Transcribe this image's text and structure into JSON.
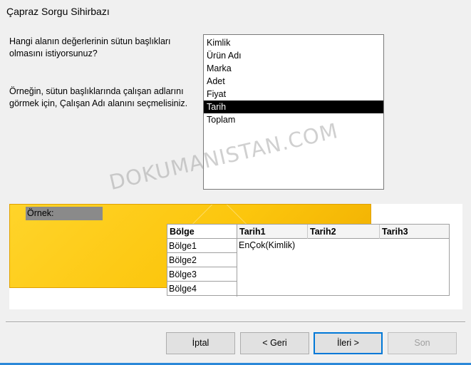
{
  "window": {
    "title": "Çapraz Sorgu Sihirbazı"
  },
  "instructions": {
    "question": "Hangi alanın değerlerinin sütun başlıkları olmasını istiyorsunuz?",
    "hint": "Örneğin, sütun başlıklarında çalışan adlarını görmek için, Çalışan Adı alanını seçmelisiniz."
  },
  "fields_list": {
    "items": [
      "Kimlik",
      "Ürün Adı",
      "Marka",
      "Adet",
      "Fiyat",
      "Tarih",
      "Toplam"
    ],
    "selected_index": 5
  },
  "watermark": "DOKUMANISTAN.COM",
  "sample": {
    "label": "Örnek:",
    "row_header_title": "Bölge",
    "row_values": [
      "Bölge1",
      "Bölge2",
      "Bölge3",
      "Bölge4"
    ],
    "column_headers": [
      "Tarih1",
      "Tarih2",
      "Tarih3"
    ],
    "value_cell": "EnÇok(Kimlik)"
  },
  "buttons": {
    "cancel": "İptal",
    "back": "< Geri",
    "next": "İleri >",
    "finish": "Son"
  },
  "colors": {
    "accent": "#0078d7",
    "selection_bg": "#000000",
    "sample_yellow": "#fcc60d"
  }
}
